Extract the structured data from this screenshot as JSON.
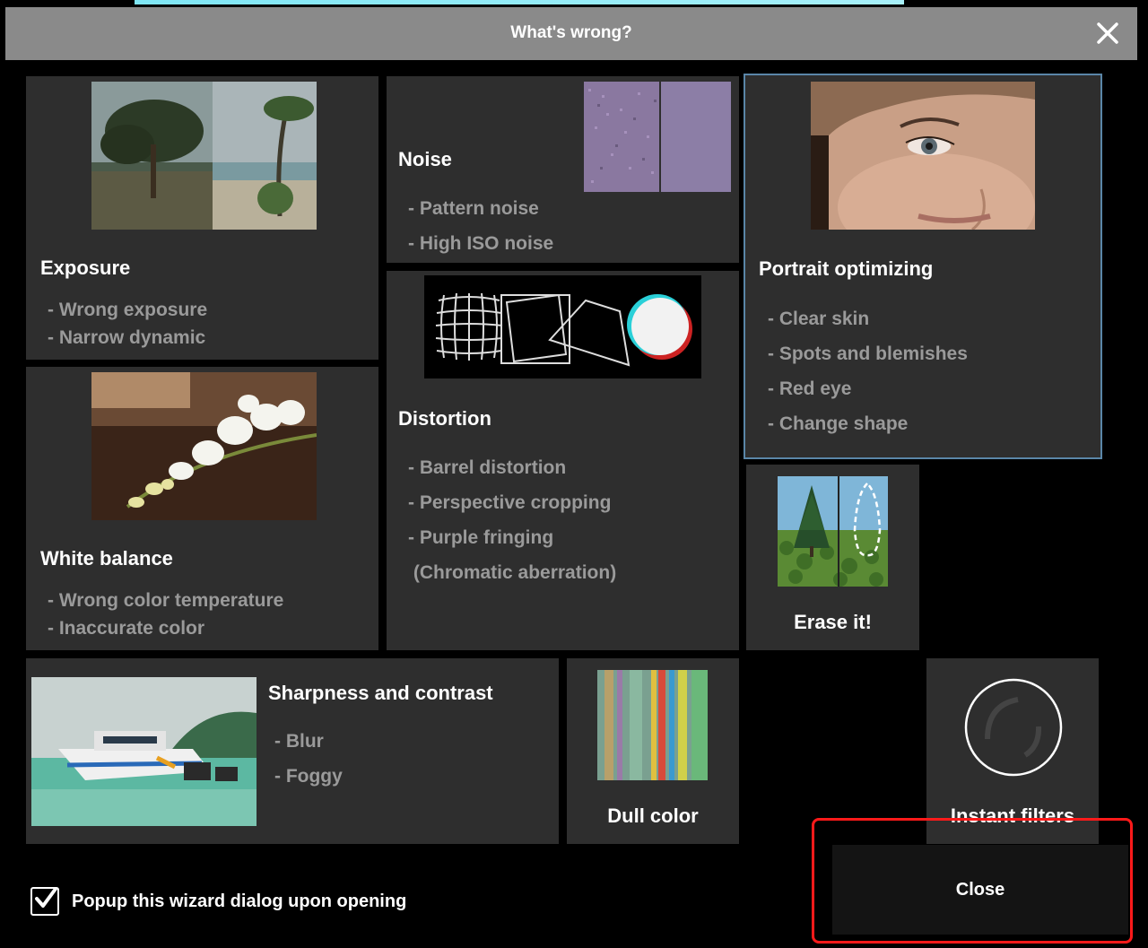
{
  "dialog": {
    "title": "What's wrong?"
  },
  "cards": {
    "exposure": {
      "title": "Exposure",
      "items": [
        "- Wrong exposure",
        "- Narrow dynamic"
      ]
    },
    "noise": {
      "title": "Noise",
      "items": [
        "- Pattern noise",
        "- High ISO noise"
      ]
    },
    "portrait": {
      "title": "Portrait optimizing",
      "items": [
        "- Clear skin",
        "- Spots and blemishes",
        "- Red eye",
        "- Change shape"
      ]
    },
    "white_balance": {
      "title": "White balance",
      "items": [
        "- Wrong color temperature",
        "- Inaccurate color"
      ]
    },
    "distortion": {
      "title": "Distortion",
      "items": [
        "- Barrel distortion",
        "- Perspective cropping",
        "- Purple fringing",
        " (Chromatic aberration)"
      ]
    },
    "erase": {
      "title": "Erase it!"
    },
    "sharpness": {
      "title": "Sharpness and contrast",
      "items": [
        "- Blur",
        "- Foggy"
      ]
    },
    "dull_color": {
      "title": "Dull color"
    },
    "instant_filters": {
      "title": "Instant filters"
    }
  },
  "footer": {
    "checkbox_label": "Popup this wizard dialog upon opening",
    "checkbox_checked": true,
    "close_label": "Close"
  },
  "colors": {
    "titlebar": "#8a8a8a",
    "card_bg": "#2e2e2e",
    "selected_border": "#5a86a8",
    "highlight": "#ff1a1a"
  }
}
